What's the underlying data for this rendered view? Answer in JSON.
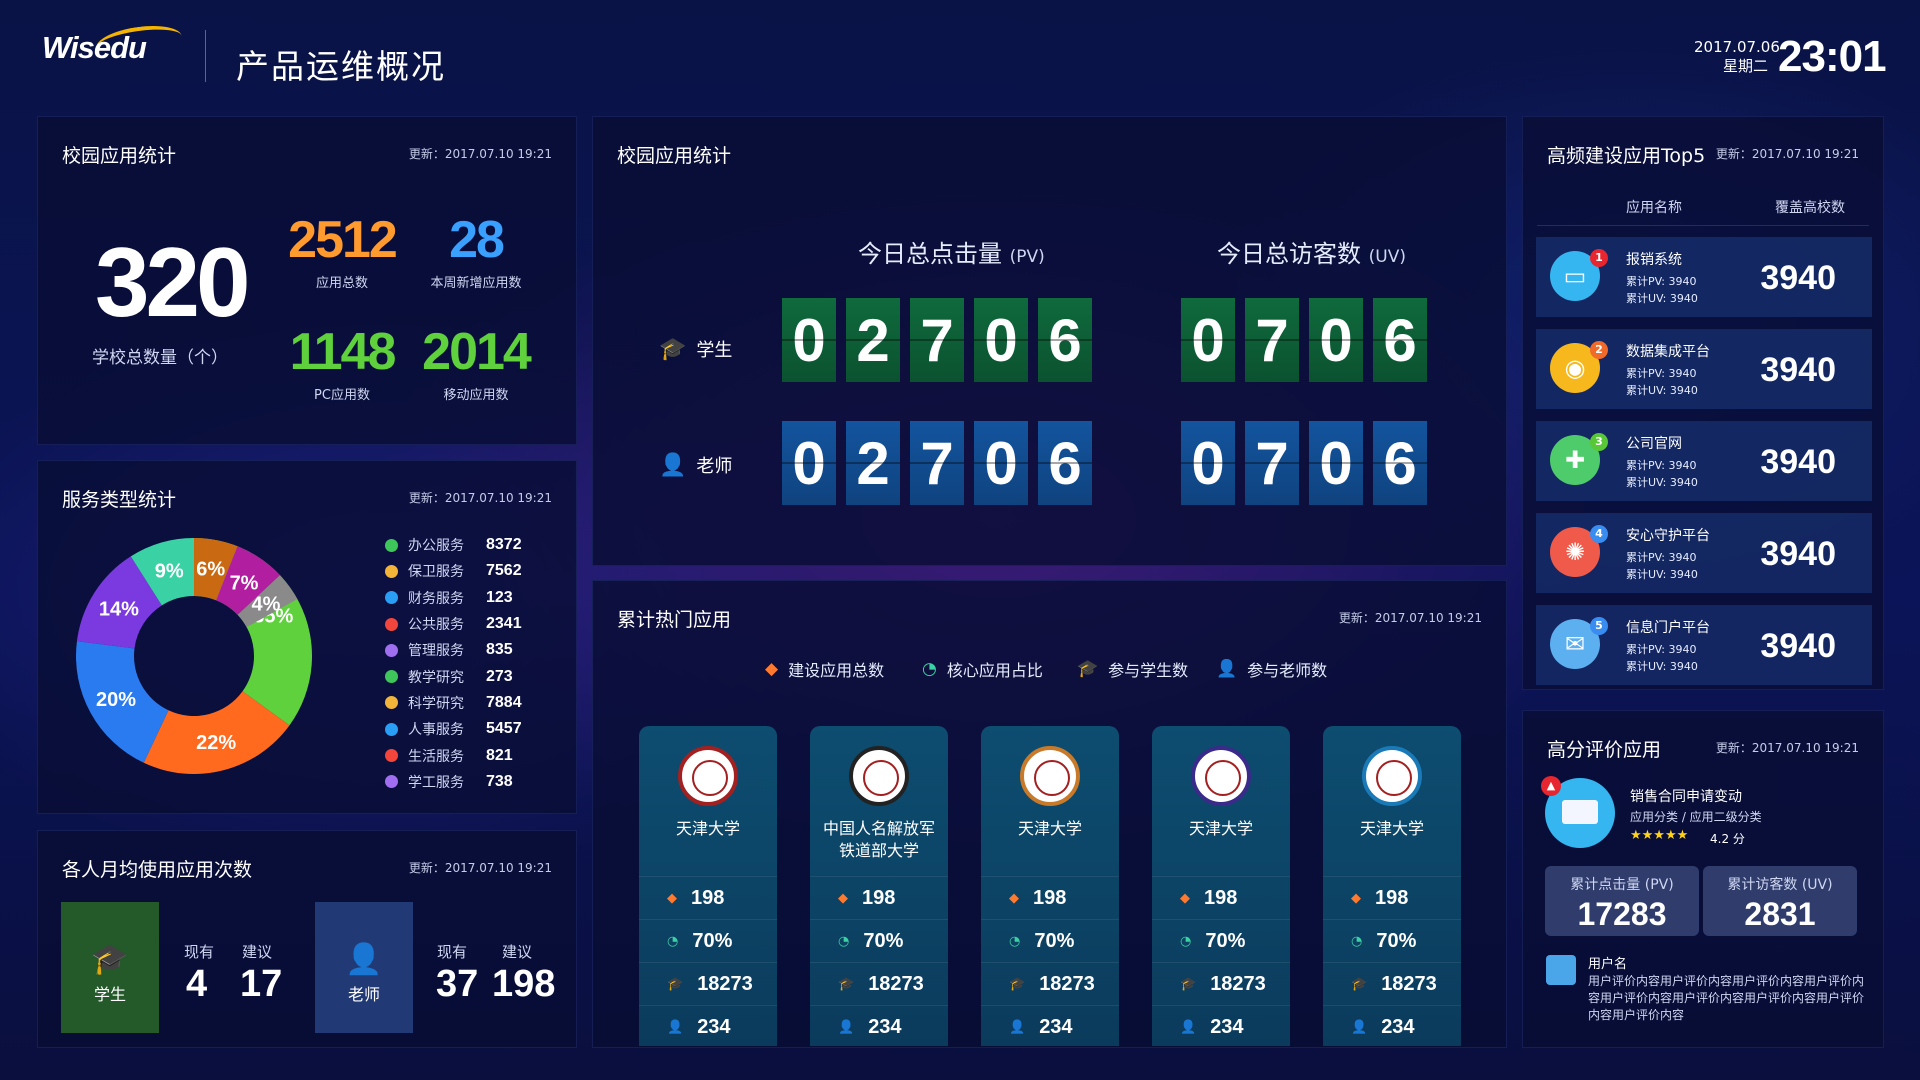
{
  "header": {
    "logo": "Wisedu",
    "title": "产品运维概况",
    "date": "2017.07.06",
    "weekday": "星期二",
    "time": "23:01"
  },
  "campus_stats": {
    "title": "校园应用统计",
    "update": "更新：2017.07.10 19:21",
    "total_schools": "320",
    "total_schools_label": "学校总数量（个）",
    "stats": [
      {
        "value": "2512",
        "label": "应用总数",
        "color": "#ff9a2e"
      },
      {
        "value": "28",
        "label": "本周新增应用数",
        "color": "#3aa0ff"
      },
      {
        "value": "1148",
        "label": "PC应用数",
        "color": "#5fd13c"
      },
      {
        "value": "2014",
        "label": "移动应用数",
        "color": "#5fd13c"
      }
    ]
  },
  "service_types": {
    "title": "服务类型统计",
    "update": "更新：2017.07.10 19:21",
    "chart_data": {
      "type": "pie",
      "donut": true,
      "slices": [
        {
          "pct": 35,
          "label": "35%",
          "color": "#5fd13c"
        },
        {
          "pct": 22,
          "label": "22%",
          "color": "#ff6a1e"
        },
        {
          "pct": 20,
          "label": "20%",
          "color": "#2b7bf0"
        },
        {
          "pct": 14,
          "label": "14%",
          "color": "#7b3ae0"
        },
        {
          "pct": 9,
          "label": "9%",
          "color": "#3ad2a5"
        },
        {
          "pct": 6,
          "label": "6%",
          "color": "#c96a12"
        },
        {
          "pct": 7,
          "label": "7%",
          "color": "#b21ea0"
        },
        {
          "pct": 4,
          "label": "4%",
          "color": "#8a8a8a"
        }
      ],
      "legend": [
        {
          "name": "办公服务",
          "value": "8372",
          "color": "#3ec65a"
        },
        {
          "name": "保卫服务",
          "value": "7562",
          "color": "#f2b53a"
        },
        {
          "name": "财务服务",
          "value": "123",
          "color": "#2a9df4"
        },
        {
          "name": "公共服务",
          "value": "2341",
          "color": "#f2463c"
        },
        {
          "name": "管理服务",
          "value": "835",
          "color": "#a06ef0"
        },
        {
          "name": "教学研究",
          "value": "273",
          "color": "#3ec65a"
        },
        {
          "name": "科学研究",
          "value": "7884",
          "color": "#f2b53a"
        },
        {
          "name": "人事服务",
          "value": "5457",
          "color": "#2a9df4"
        },
        {
          "name": "生活服务",
          "value": "821",
          "color": "#f2463c"
        },
        {
          "name": "学工服务",
          "value": "738",
          "color": "#a06ef0"
        }
      ]
    }
  },
  "monthly": {
    "title": "各人月均使用应用次数",
    "update": "更新：2017.07.10 19:21",
    "current_label": "现有",
    "suggest_label": "建议",
    "student": {
      "label": "学生",
      "current": "4",
      "suggest": "17"
    },
    "teacher": {
      "label": "老师",
      "current": "37",
      "suggest": "198"
    }
  },
  "pvuv": {
    "title": "校园应用统计",
    "pv_label": "今日总点击量",
    "pv_unit": "(PV)",
    "uv_label": "今日总访客数",
    "uv_unit": "(UV)",
    "student_label": "学生",
    "teacher_label": "老师",
    "student_pv": [
      "0",
      "2",
      "7",
      "0",
      "6"
    ],
    "student_uv": [
      "0",
      "7",
      "0",
      "6"
    ],
    "teacher_pv": [
      "0",
      "2",
      "7",
      "0",
      "6"
    ],
    "teacher_uv": [
      "0",
      "7",
      "0",
      "6"
    ]
  },
  "hot_apps": {
    "title": "累计热门应用",
    "update": "更新：2017.07.10 19:21",
    "legend": [
      {
        "label": "建设应用总数",
        "icon": "cube-icon"
      },
      {
        "label": "核心应用占比",
        "icon": "pie-icon"
      },
      {
        "label": "参与学生数",
        "icon": "graduation-cap-icon"
      },
      {
        "label": "参与老师数",
        "icon": "person-icon"
      }
    ],
    "cards": [
      {
        "name": "天津大学",
        "seal_color": "#a32020",
        "apps": "198",
        "ratio": "70%",
        "students": "18273",
        "teachers": "234"
      },
      {
        "name": "中国人名解放军铁道部大学",
        "seal_color": "#222222",
        "apps": "198",
        "ratio": "70%",
        "students": "18273",
        "teachers": "234"
      },
      {
        "name": "天津大学",
        "seal_color": "#c87a2a",
        "apps": "198",
        "ratio": "70%",
        "students": "18273",
        "teachers": "234"
      },
      {
        "name": "天津大学",
        "seal_color": "#3a2a8a",
        "apps": "198",
        "ratio": "70%",
        "students": "18273",
        "teachers": "234"
      },
      {
        "name": "天津大学",
        "seal_color": "#1a7ab8",
        "apps": "198",
        "ratio": "70%",
        "students": "18273",
        "teachers": "234"
      }
    ]
  },
  "top5": {
    "title": "高频建设应用Top5",
    "update": "更新：2017.07.10 19:21",
    "col_name": "应用名称",
    "col_cover": "覆盖高校数",
    "pv_prefix": "累计PV:",
    "uv_prefix": "累计UV:",
    "items": [
      {
        "rank": "1",
        "name": "报销系统",
        "pv": "3940",
        "uv": "3940",
        "value": "3940",
        "icon": "monitor-icon",
        "icon_bg": "#35b6f0",
        "badge_bg": "#e8262f"
      },
      {
        "rank": "2",
        "name": "数据集成平台",
        "pv": "3940",
        "uv": "3940",
        "value": "3940",
        "icon": "database-icon",
        "icon_bg": "#f6b81c",
        "badge_bg": "#f06a2a"
      },
      {
        "rank": "3",
        "name": "公司官网",
        "pv": "3940",
        "uv": "3940",
        "value": "3940",
        "icon": "gamepad-icon",
        "icon_bg": "#4ecb6b",
        "badge_bg": "#58c738"
      },
      {
        "rank": "4",
        "name": "安心守护平台",
        "pv": "3940",
        "uv": "3940",
        "value": "3940",
        "icon": "network-icon",
        "icon_bg": "#f05a4a",
        "badge_bg": "#3a8df0"
      },
      {
        "rank": "5",
        "name": "信息门户平台",
        "pv": "3940",
        "uv": "3940",
        "value": "3940",
        "icon": "mail-icon",
        "icon_bg": "#5db0f0",
        "badge_bg": "#3a8df0"
      }
    ]
  },
  "review": {
    "title": "高分评价应用",
    "update": "更新：2017.07.10 19:21",
    "app_name": "销售合同申请变动",
    "category": "应用分类 / 应用二级分类",
    "stars": "★★★★★",
    "score": "4.2 分",
    "pv_label": "累计点击量 (PV)",
    "pv": "17283",
    "uv_label": "累计访客数 (UV)",
    "uv": "2831",
    "user": "用户名",
    "comment": "用户评价内容用户评价内容用户评价内容用户评价内容用户评价内容用户评价内容用户评价内容用户评价内容用户评价内容"
  }
}
